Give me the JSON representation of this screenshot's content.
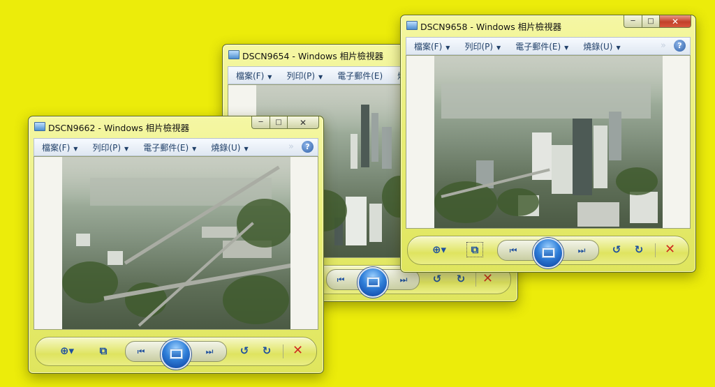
{
  "windows": [
    {
      "title": "DSCN9654 - Windows 相片檢視器",
      "menus": [
        "檔案(F)",
        "列印(P)",
        "電子郵件(E)",
        "燒"
      ]
    },
    {
      "title": "DSCN9662 - Windows 相片檢視器",
      "menus": [
        "檔案(F)",
        "列印(P)",
        "電子郵件(E)",
        "燒錄(U)"
      ]
    },
    {
      "title": "DSCN9658 - Windows 相片檢視器",
      "menus": [
        "檔案(F)",
        "列印(P)",
        "電子郵件(E)",
        "燒錄(U)"
      ]
    }
  ],
  "caption_buttons": {
    "minimize": "─",
    "maximize": "□",
    "close": "✕"
  },
  "controls": {
    "zoom": "⊕▾",
    "fit": "⧉",
    "prev": "⏮",
    "next": "⏭",
    "rotate_ccw": "↺",
    "rotate_cw": "↻",
    "delete": "✕",
    "help": "?",
    "overflow": "»"
  },
  "icons": [
    "photo-viewer-icon",
    "zoom-icon",
    "fit-to-window-icon",
    "previous-icon",
    "slideshow-icon",
    "next-icon",
    "rotate-counterclockwise-icon",
    "rotate-clockwise-icon",
    "delete-icon",
    "help-icon"
  ],
  "colors": {
    "desktop": "#ecec0a",
    "chrome": "#e6eb70",
    "menu_text": "#1f3f68",
    "control_blue": "#1d4f9e",
    "delete_red": "#cf2a1f"
  }
}
